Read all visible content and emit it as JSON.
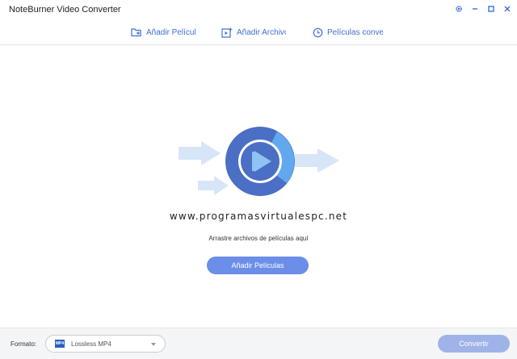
{
  "window": {
    "title": "NoteBurner Video Converter",
    "controls": [
      {
        "name": "settings-icon"
      },
      {
        "name": "minimize-icon"
      },
      {
        "name": "maximize-icon"
      },
      {
        "name": "close-icon"
      }
    ]
  },
  "toolbar": {
    "add_movies": {
      "label": "Añadir Películ",
      "icon": "folder-add-icon"
    },
    "add_file": {
      "label": "Añadir Archivc",
      "icon": "video-file-add-icon"
    },
    "converted": {
      "label": "Películas converti",
      "icon": "clock-icon"
    }
  },
  "main": {
    "watermark": "www.programasvirtualespc.net",
    "drop_hint": "Arrastre archivos de películas aquí",
    "add_button": "Añadir Películas"
  },
  "footer": {
    "format_label": "Formato:",
    "format_value": "Lossless MP4",
    "format_icon_text": "MP4",
    "convert_button": "Convertir"
  },
  "colors": {
    "accent": "#3d6fd6",
    "button": "#6b8ee8",
    "button_disabled": "#9fb3e8",
    "disc_outer": "#4a6fc4",
    "disc_arc": "#62a8ee",
    "arrow": "#d6e6f8"
  }
}
